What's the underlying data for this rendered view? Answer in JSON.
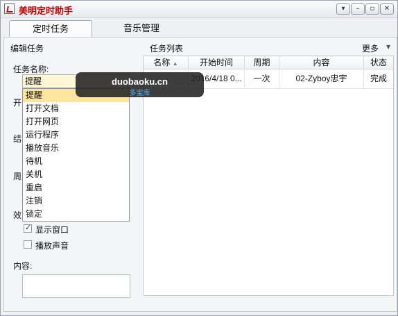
{
  "window": {
    "title": "美明定时助手"
  },
  "tabs": [
    {
      "label": "定时任务"
    },
    {
      "label": "音乐管理"
    }
  ],
  "left": {
    "section_title": "编辑任务",
    "task_name_label": "任务名称:",
    "selected_value": "提醒",
    "options": [
      "提醒",
      "打开文档",
      "打开网页",
      "运行程序",
      "播放音乐",
      "待机",
      "关机",
      "重启",
      "注销",
      "锁定"
    ],
    "partial_labels": [
      "开",
      "结",
      "周",
      "效"
    ],
    "checkboxes": [
      {
        "label": "显示窗口",
        "checked": true
      },
      {
        "label": "播放声音",
        "checked": false
      }
    ],
    "content_label": "内容:"
  },
  "right": {
    "section_title": "任务列表",
    "more_label": "更多",
    "columns": [
      "名称",
      "开始时间",
      "周期",
      "内容",
      "状态"
    ],
    "rows": [
      {
        "name": "",
        "start": "2016/4/18 0...",
        "period": "一次",
        "content": "02-Zyboy忠宇",
        "status": "完成"
      }
    ]
  },
  "watermark": {
    "line1": "duobaoku.cn",
    "line2": "多宝库"
  }
}
